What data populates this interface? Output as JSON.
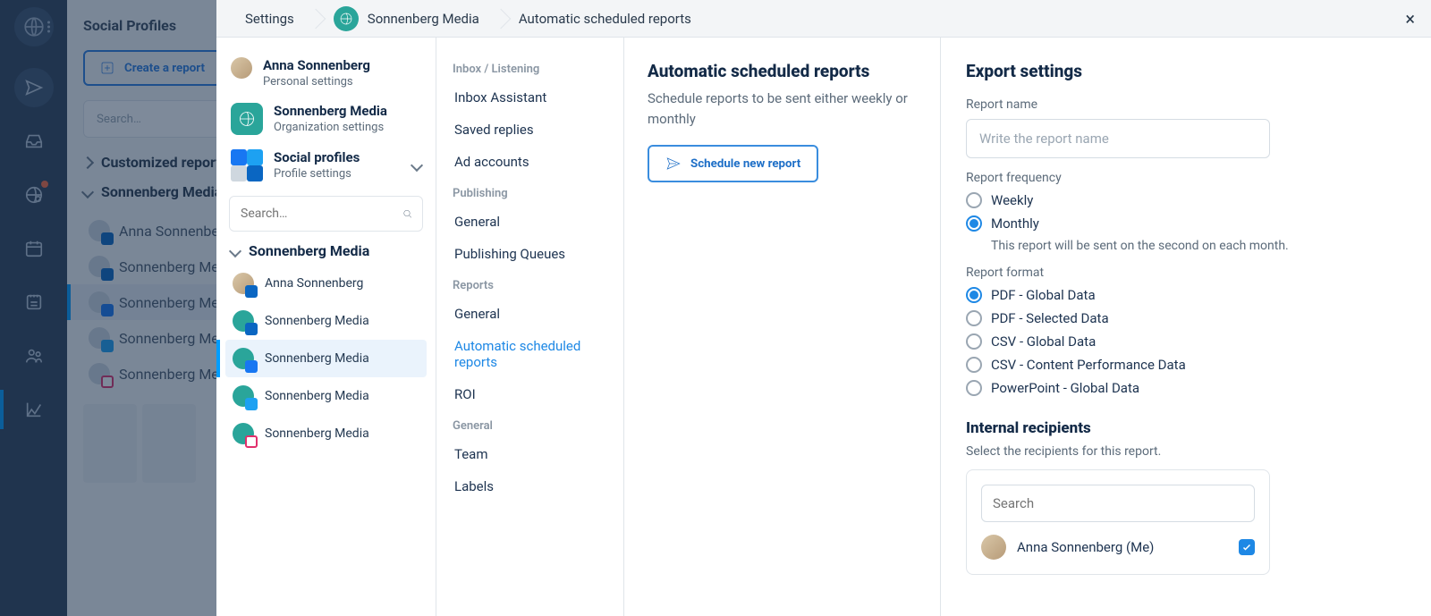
{
  "rail": {
    "icons": [
      "logo",
      "send",
      "inbox",
      "monitor",
      "calendar",
      "notes",
      "team",
      "reports"
    ]
  },
  "bg": {
    "header": "Social Profiles",
    "create_btn": "Create a report",
    "search_placeholder": "Search…",
    "sections": {
      "customized": "Customized reports",
      "org": "Sonnenberg Media"
    },
    "profiles": [
      {
        "name": "Anna Sonnenberg",
        "net": "li"
      },
      {
        "name": "Sonnenberg Media",
        "net": "li"
      },
      {
        "name": "Sonnenberg Media",
        "net": "fb",
        "active": true
      },
      {
        "name": "Sonnenberg Media",
        "net": "tw"
      },
      {
        "name": "Sonnenberg Media",
        "net": "ig"
      }
    ]
  },
  "breadcrumb": {
    "c1": "Settings",
    "c2": "Sonnenberg Media",
    "c3": "Automatic scheduled reports"
  },
  "col1": {
    "user": {
      "name": "Anna Sonnenberg",
      "sub": "Personal settings"
    },
    "org": {
      "name": "Sonnenberg Media",
      "sub": "Organization settings"
    },
    "social": {
      "name": "Social profiles",
      "sub": "Profile settings"
    },
    "search_placeholder": "Search…",
    "group": "Sonnenberg Media",
    "accounts": [
      {
        "name": "Anna Sonnenberg",
        "net": "li",
        "av": "person"
      },
      {
        "name": "Sonnenberg Media",
        "net": "li",
        "av": "org"
      },
      {
        "name": "Sonnenberg Media",
        "net": "fb",
        "av": "org",
        "selected": true
      },
      {
        "name": "Sonnenberg Media",
        "net": "tw",
        "av": "org"
      },
      {
        "name": "Sonnenberg Media",
        "net": "ig",
        "av": "org"
      }
    ]
  },
  "col2": {
    "groups": [
      {
        "hdr": "Inbox / Listening",
        "items": [
          "Inbox Assistant",
          "Saved replies",
          "Ad accounts"
        ]
      },
      {
        "hdr": "Publishing",
        "items": [
          "General",
          "Publishing Queues"
        ]
      },
      {
        "hdr": "Reports",
        "items": [
          "General",
          "Automatic scheduled reports",
          "ROI"
        ],
        "active_index": 1
      },
      {
        "hdr": "General",
        "items": [
          "Team",
          "Labels"
        ]
      }
    ]
  },
  "col3": {
    "title": "Automatic scheduled reports",
    "desc": "Schedule reports to be sent either weekly or monthly",
    "btn": "Schedule new report"
  },
  "col4": {
    "title": "Export settings",
    "name_label": "Report name",
    "name_ph": "Write the report name",
    "freq_label": "Report frequency",
    "freq": [
      {
        "label": "Weekly",
        "sel": false
      },
      {
        "label": "Monthly",
        "sel": true,
        "hint": "This report will be sent on the second on each month."
      }
    ],
    "fmt_label": "Report format",
    "fmt": [
      {
        "label": "PDF - Global Data",
        "sel": true
      },
      {
        "label": "PDF - Selected Data"
      },
      {
        "label": "CSV - Global Data"
      },
      {
        "label": "CSV - Content Performance Data"
      },
      {
        "label": "PowerPoint - Global Data"
      }
    ],
    "recipients_title": "Internal recipients",
    "recipients_desc": "Select the recipients for this report.",
    "rec_search_ph": "Search",
    "recipients": [
      {
        "name": "Anna Sonnenberg (Me)",
        "checked": true
      }
    ]
  }
}
